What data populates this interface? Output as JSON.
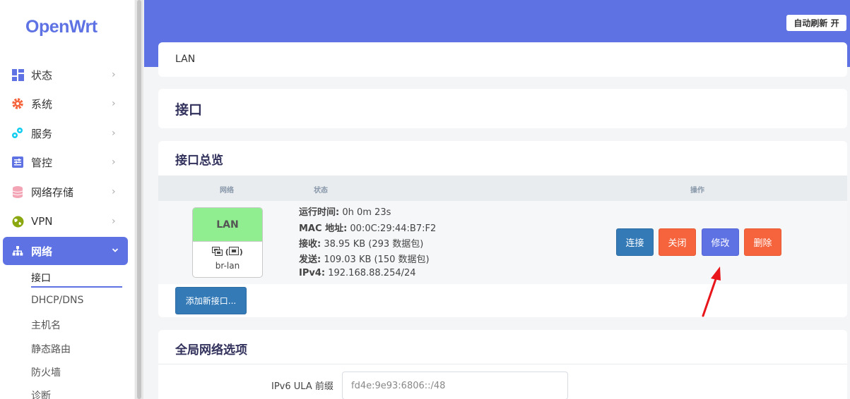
{
  "app": {
    "logo": "OpenWrt"
  },
  "sidebar": {
    "items": [
      {
        "label": "状态",
        "icon": "dashboard-icon"
      },
      {
        "label": "系统",
        "icon": "gear-icon"
      },
      {
        "label": "服务",
        "icon": "services-icon"
      },
      {
        "label": "管控",
        "icon": "sliders-icon"
      },
      {
        "label": "网络存储",
        "icon": "storage-icon"
      },
      {
        "label": "VPN",
        "icon": "globe-icon"
      },
      {
        "label": "网络",
        "icon": "network-icon"
      }
    ],
    "chevron": "›",
    "chevron_open": "⌄",
    "sub_items": [
      "接口",
      "DHCP/DNS",
      "主机名",
      "静态路由",
      "防火墙",
      "诊断"
    ]
  },
  "header": {
    "auto_refresh": "自动刷新 开"
  },
  "breadcrumb": "LAN",
  "page_title": "接口",
  "overview": {
    "title": "接口总览",
    "columns": [
      "网络",
      "状态",
      "操作"
    ],
    "interface": {
      "name": "LAN",
      "icons_text": "(",
      "icons_text_end": ")",
      "device": "br-lan",
      "color": "#90ee90"
    },
    "status": [
      {
        "label": "运行时间:",
        "value": "0h 0m 23s"
      },
      {
        "label": "MAC 地址:",
        "value": "00:0C:29:44:B7:F2"
      },
      {
        "label": "接收:",
        "value": "38.95 KB (293 数据包)"
      },
      {
        "label": "发送:",
        "value": "109.03 KB (150 数据包)"
      },
      {
        "label": "IPv4:",
        "value": "192.168.88.254/24"
      }
    ],
    "actions": {
      "connect": "连接",
      "close": "关闭",
      "edit": "修改",
      "delete": "删除"
    },
    "add_button": "添加新接口..."
  },
  "global": {
    "title": "全局网络选项",
    "ula_label": "IPv6 ULA 前缀",
    "ula_value": "fd4e:9e93:6806::/48"
  },
  "colors": {
    "accent": "#5e72e4",
    "primary": "#337ab7",
    "danger": "#f5643c",
    "annotation": "#e8161b"
  }
}
